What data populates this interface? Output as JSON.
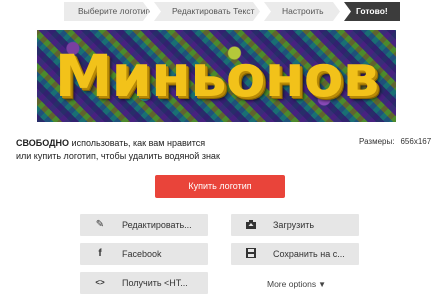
{
  "steps": [
    {
      "label": "Выберите логотип"
    },
    {
      "label": "Редактировать Текст"
    },
    {
      "label": "Настроить"
    },
    {
      "label": "Готово!"
    }
  ],
  "logo": {
    "text": "Миньонов"
  },
  "info": {
    "free": "СВОБОДНО",
    "line1_rest": " использовать, как вам нравится",
    "line2": "или купить логотип, чтобы удалить водяной знак"
  },
  "size": {
    "label": "Размеры:",
    "value": "656x167"
  },
  "buy": {
    "label": "Купить логотип"
  },
  "actions": {
    "edit": "Редактировать...",
    "upload": "Загрузить",
    "facebook": "Facebook",
    "save": "Сохранить на с...",
    "embed": "Получить <HT...",
    "more": "More options"
  },
  "icons": {
    "edit": "pencil-icon",
    "upload": "upload-icon",
    "facebook": "facebook-icon",
    "save": "save-icon",
    "embed": "code-icon",
    "more": "caret-down-icon"
  },
  "colors": {
    "buy": "#e9443a",
    "active_step": "#3c3c3c",
    "logo_text": "#f2c21a"
  }
}
